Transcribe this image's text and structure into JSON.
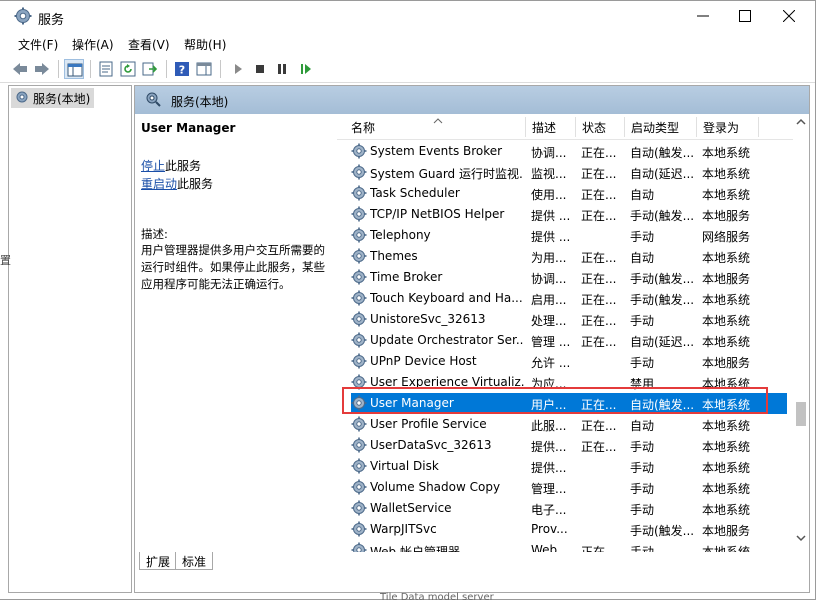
{
  "window": {
    "title": "服务",
    "minimize_symbol": "—",
    "maximize_symbol": "☐",
    "close_symbol": "✕"
  },
  "menu": {
    "items": [
      "文件(F)",
      "操作(A)",
      "查看(V)",
      "帮助(H)"
    ]
  },
  "toolbar": {
    "icons": [
      "back-arrow-icon",
      "forward-arrow-icon",
      "console-tree-icon",
      "properties-icon",
      "refresh-icon",
      "export-list-icon",
      "help-icon",
      "show-hide-action-pane-icon",
      "start-service-icon",
      "stop-service-icon",
      "pause-service-icon",
      "restart-service-icon"
    ]
  },
  "tree": {
    "root_label": "服务(本地)"
  },
  "panel": {
    "header_title": "服务(本地)",
    "selected_name": "User Manager",
    "stop_link": "停止",
    "stop_suffix": "此服务",
    "restart_link": "重启动",
    "restart_suffix": "此服务",
    "desc_label": "描述:",
    "description": "用户管理器提供多用户交互所需要的运行时组件。如果停止此服务，某些应用程序可能无法正确运行。"
  },
  "table": {
    "columns": [
      "名称",
      "描述",
      "状态",
      "启动类型",
      "登录为"
    ],
    "sort_indicator": "^",
    "rows": [
      {
        "name": "System Events Broker",
        "desc": "协调...",
        "status": "正在...",
        "startup": "自动(触发...",
        "logon": "本地系统"
      },
      {
        "name": "System Guard 运行时监视...",
        "desc": "监视...",
        "status": "正在...",
        "startup": "自动(延迟...",
        "logon": "本地系统"
      },
      {
        "name": "Task Scheduler",
        "desc": "使用...",
        "status": "正在...",
        "startup": "自动",
        "logon": "本地系统"
      },
      {
        "name": "TCP/IP NetBIOS Helper",
        "desc": "提供 ...",
        "status": "正在...",
        "startup": "手动(触发...",
        "logon": "本地服务"
      },
      {
        "name": "Telephony",
        "desc": "提供 ...",
        "status": "",
        "startup": "手动",
        "logon": "网络服务"
      },
      {
        "name": "Themes",
        "desc": "为用...",
        "status": "正在...",
        "startup": "自动",
        "logon": "本地系统"
      },
      {
        "name": "Time Broker",
        "desc": "协调...",
        "status": "正在...",
        "startup": "手动(触发...",
        "logon": "本地服务"
      },
      {
        "name": "Touch Keyboard and Ha...",
        "desc": "启用...",
        "status": "正在...",
        "startup": "手动(触发...",
        "logon": "本地系统"
      },
      {
        "name": "UnistoreSvc_32613",
        "desc": "处理...",
        "status": "正在...",
        "startup": "手动",
        "logon": "本地系统"
      },
      {
        "name": "Update Orchestrator Ser...",
        "desc": "管理 ...",
        "status": "正在...",
        "startup": "自动(延迟...",
        "logon": "本地系统"
      },
      {
        "name": "UPnP Device Host",
        "desc": "允许 ...",
        "status": "",
        "startup": "手动",
        "logon": "本地服务"
      },
      {
        "name": "User Experience Virtualiz...",
        "desc": "为应...",
        "status": "",
        "startup": "禁用",
        "logon": "本地系统"
      },
      {
        "name": "User Manager",
        "desc": "用户...",
        "status": "正在...",
        "startup": "自动(触发...",
        "logon": "本地系统"
      },
      {
        "name": "User Profile Service",
        "desc": "此服...",
        "status": "正在...",
        "startup": "自动",
        "logon": "本地系统"
      },
      {
        "name": "UserDataSvc_32613",
        "desc": "提供...",
        "status": "正在...",
        "startup": "手动",
        "logon": "本地系统"
      },
      {
        "name": "Virtual Disk",
        "desc": "提供...",
        "status": "",
        "startup": "手动",
        "logon": "本地系统"
      },
      {
        "name": "Volume Shadow Copy",
        "desc": "管理...",
        "status": "",
        "startup": "手动",
        "logon": "本地系统"
      },
      {
        "name": "WalletService",
        "desc": "电子...",
        "status": "",
        "startup": "手动",
        "logon": "本地系统"
      },
      {
        "name": "WarpJITSvc",
        "desc": "Prov...",
        "status": "",
        "startup": "手动(触发...",
        "logon": "本地服务"
      },
      {
        "name": "Web 帐户管理器",
        "desc": "Web...",
        "status": "正在...",
        "startup": "手动",
        "logon": "本地系统"
      }
    ],
    "selected_index": 12
  },
  "tabs": [
    "扩展",
    "标准"
  ],
  "fragments": {
    "bottom": "Tile Data model server",
    "left": "置"
  },
  "colors": {
    "selection": "#0078d7",
    "header_band": "#a8c0d8",
    "link": "#1a4fa8",
    "highlight_box": "#e43b3b"
  }
}
